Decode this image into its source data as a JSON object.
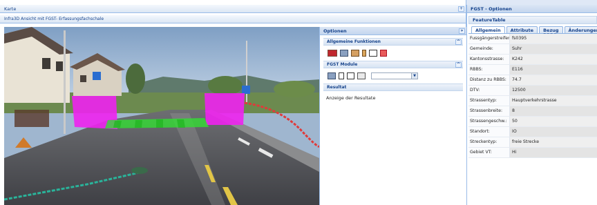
{
  "left_panel": {
    "title": "Karte",
    "subtitle": "Infra3D Ansicht mit FGST- Erfassungsfachschale",
    "collapse_icon": "plus-icon"
  },
  "options_panel": {
    "title": "Optionen",
    "collapse_icon": "chevron-right-icon",
    "general": {
      "title": "Allgemeine Funktionen",
      "icons": [
        "photo-icon",
        "fgst-icon",
        "measure-icon",
        "height-icon",
        "arrow-line-icon",
        "eraser-icon"
      ]
    },
    "modules": {
      "title": "FGST Module",
      "icons": [
        "fgst-icon",
        "cursor-icon",
        "line-tool-icon",
        "crosswalk-icon"
      ],
      "select_value": ""
    },
    "result": {
      "title": "Resultat",
      "text": "Anzeige der Resultate"
    }
  },
  "right_panel": {
    "title": "FGST - Optionen",
    "feature_table_title": "FeatureTable",
    "tabs": [
      "Allgemein",
      "Attribute",
      "Bezug RBBS",
      "Änderungen"
    ],
    "active_tab": "Allgemein",
    "rows": [
      {
        "key": "Fussgängerstreifen:",
        "value": "fs0395"
      },
      {
        "key": "Gemeinde:",
        "value": "Suhr"
      },
      {
        "key": "Kantonsstrasse:",
        "value": "K242"
      },
      {
        "key": "RBBS:",
        "value": "E116"
      },
      {
        "key": "Distanz zu RBBS:",
        "value": "74.7"
      },
      {
        "key": "DTV:",
        "value": "12500"
      },
      {
        "key": "Strassentyp:",
        "value": "Hauptverkehrstrasse"
      },
      {
        "key": "Strassenbreite:",
        "value": "8"
      },
      {
        "key": "Strassengeschw.:",
        "value": "50"
      },
      {
        "key": "Standort:",
        "value": "IO"
      },
      {
        "key": "Streckentyp:",
        "value": "freie Strecke"
      },
      {
        "key": "Gebiet VT:",
        "value": "Hi"
      }
    ]
  },
  "colors": {
    "header_blue": "#15428b",
    "overlay_magenta": "#ee22ee",
    "overlay_green": "#33dd33",
    "trace_red": "#e03a3a",
    "trace_teal": "#2ab39a"
  }
}
